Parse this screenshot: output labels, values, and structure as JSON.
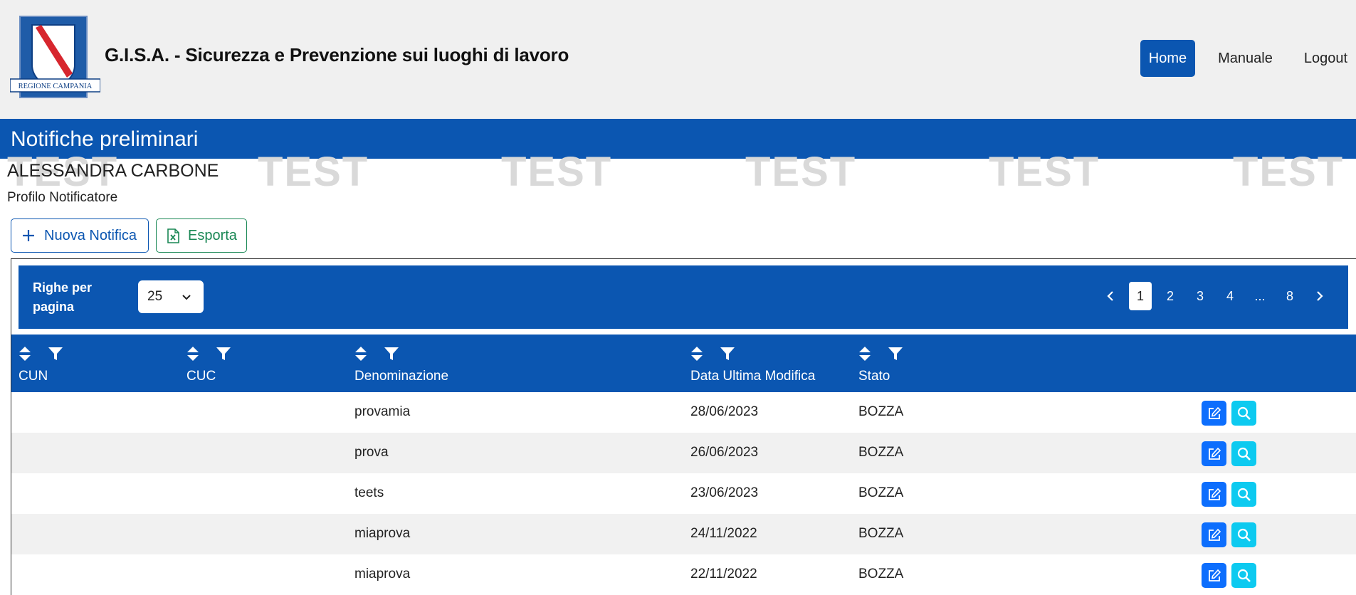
{
  "header": {
    "logo_text": "REGIONE CAMPANIA",
    "app_title": "G.I.S.A. - Sicurezza e Prevenzione sui luoghi di lavoro",
    "nav": [
      {
        "label": "Home",
        "active": true
      },
      {
        "label": "Manuale",
        "active": false
      },
      {
        "label": "Logout",
        "active": false
      }
    ]
  },
  "page": {
    "title": "Notifiche preliminari",
    "watermark": "TEST",
    "user_name": "ALESSANDRA CARBONE",
    "profile": "Profilo Notificatore"
  },
  "actions": {
    "new_label": "Nuova Notifica",
    "export_label": "Esporta"
  },
  "pager": {
    "rows_label": "Righe per pagina",
    "rows_value": "25",
    "pages": [
      "1",
      "2",
      "3",
      "4",
      "...",
      "8"
    ],
    "current_page": "1"
  },
  "table": {
    "columns": [
      "CUN",
      "CUC",
      "Denominazione",
      "Data Ultima Modifica",
      "Stato"
    ],
    "rows": [
      {
        "cun": "",
        "cuc": "",
        "denominazione": "provamia",
        "data": "28/06/2023",
        "stato": "BOZZA"
      },
      {
        "cun": "",
        "cuc": "",
        "denominazione": "prova",
        "data": "26/06/2023",
        "stato": "BOZZA"
      },
      {
        "cun": "",
        "cuc": "",
        "denominazione": "teets",
        "data": "23/06/2023",
        "stato": "BOZZA"
      },
      {
        "cun": "",
        "cuc": "",
        "denominazione": "miaprova",
        "data": "24/11/2022",
        "stato": "BOZZA"
      },
      {
        "cun": "",
        "cuc": "",
        "denominazione": "miaprova",
        "data": "22/11/2022",
        "stato": "BOZZA"
      }
    ]
  },
  "colors": {
    "primary": "#0b56b1",
    "header_bg": "#f0f0f0",
    "edit_button": "#0d6efd",
    "view_button": "#0dcaf0",
    "export_green": "#198754"
  }
}
